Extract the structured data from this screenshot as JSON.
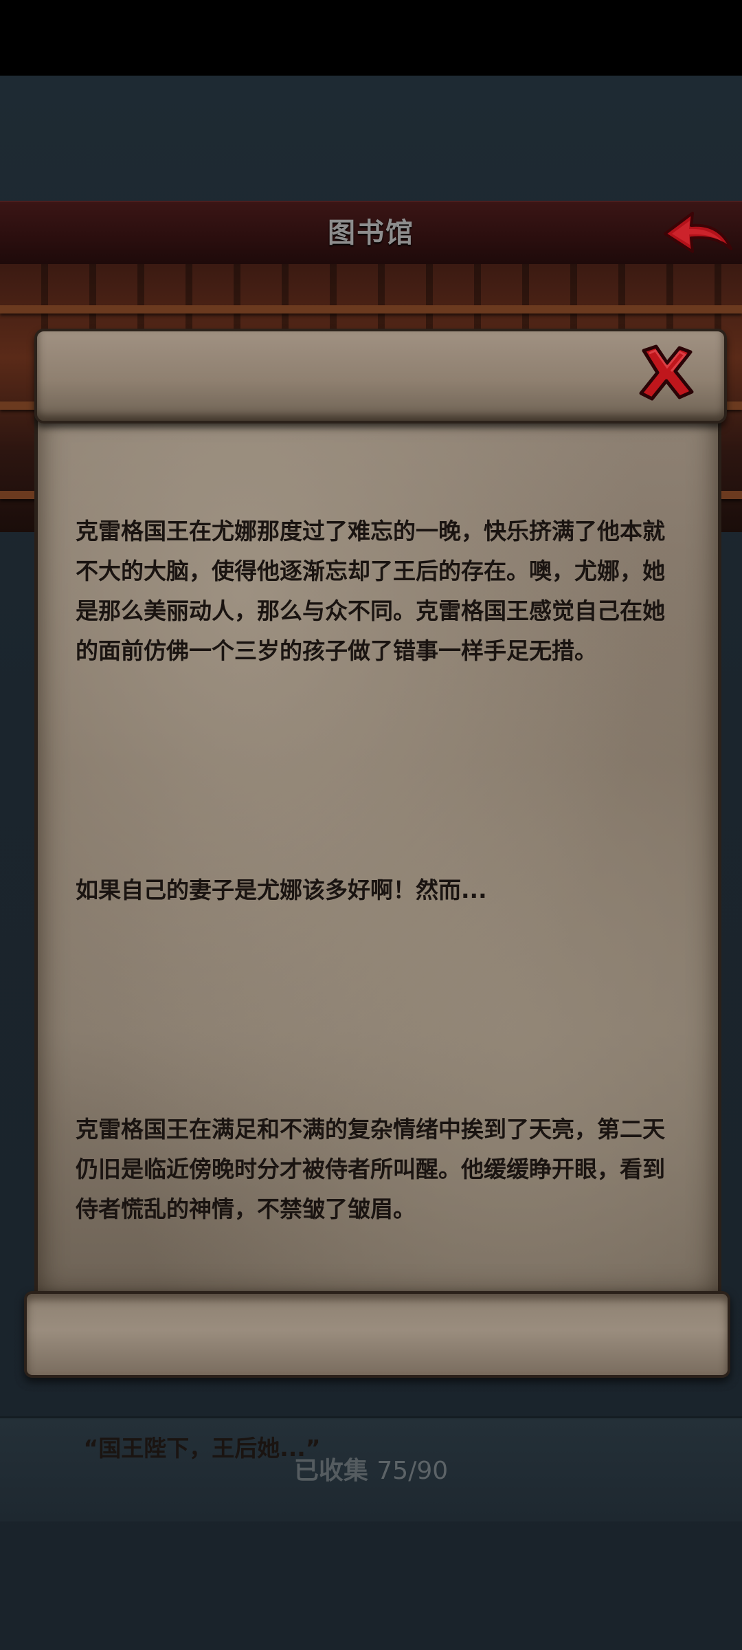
{
  "header": {
    "title": "图书馆"
  },
  "story": {
    "paragraphs": [
      "克雷格国王在尤娜那度过了难忘的一晚，快乐挤满了他本就不大的大脑，使得他逐渐忘却了王后的存在。噢，尤娜，她是那么美丽动人，那么与众不同。克雷格国王感觉自己在她的面前仿佛一个三岁的孩子做了错事一样手足无措。",
      "如果自己的妻子是尤娜该多好啊！然而...",
      "克雷格国王在满足和不满的复杂情绪中挨到了天亮，第二天仍旧是临近傍晚时分才被侍者所叫醒。他缓缓睁开眼，看到侍者慌乱的神情，不禁皱了皱眉。",
      " “国王陛下，王后她...”"
    ]
  },
  "footer": {
    "collected_label": "已收集",
    "collected_count": "75/90"
  },
  "colors": {
    "header_bg": "#2a0e0e",
    "parchment": "#8e8173",
    "text": "#1a1411",
    "accent_red": "#c0161c"
  },
  "icons": {
    "back": "back-arrow-icon",
    "close": "close-x-icon"
  }
}
